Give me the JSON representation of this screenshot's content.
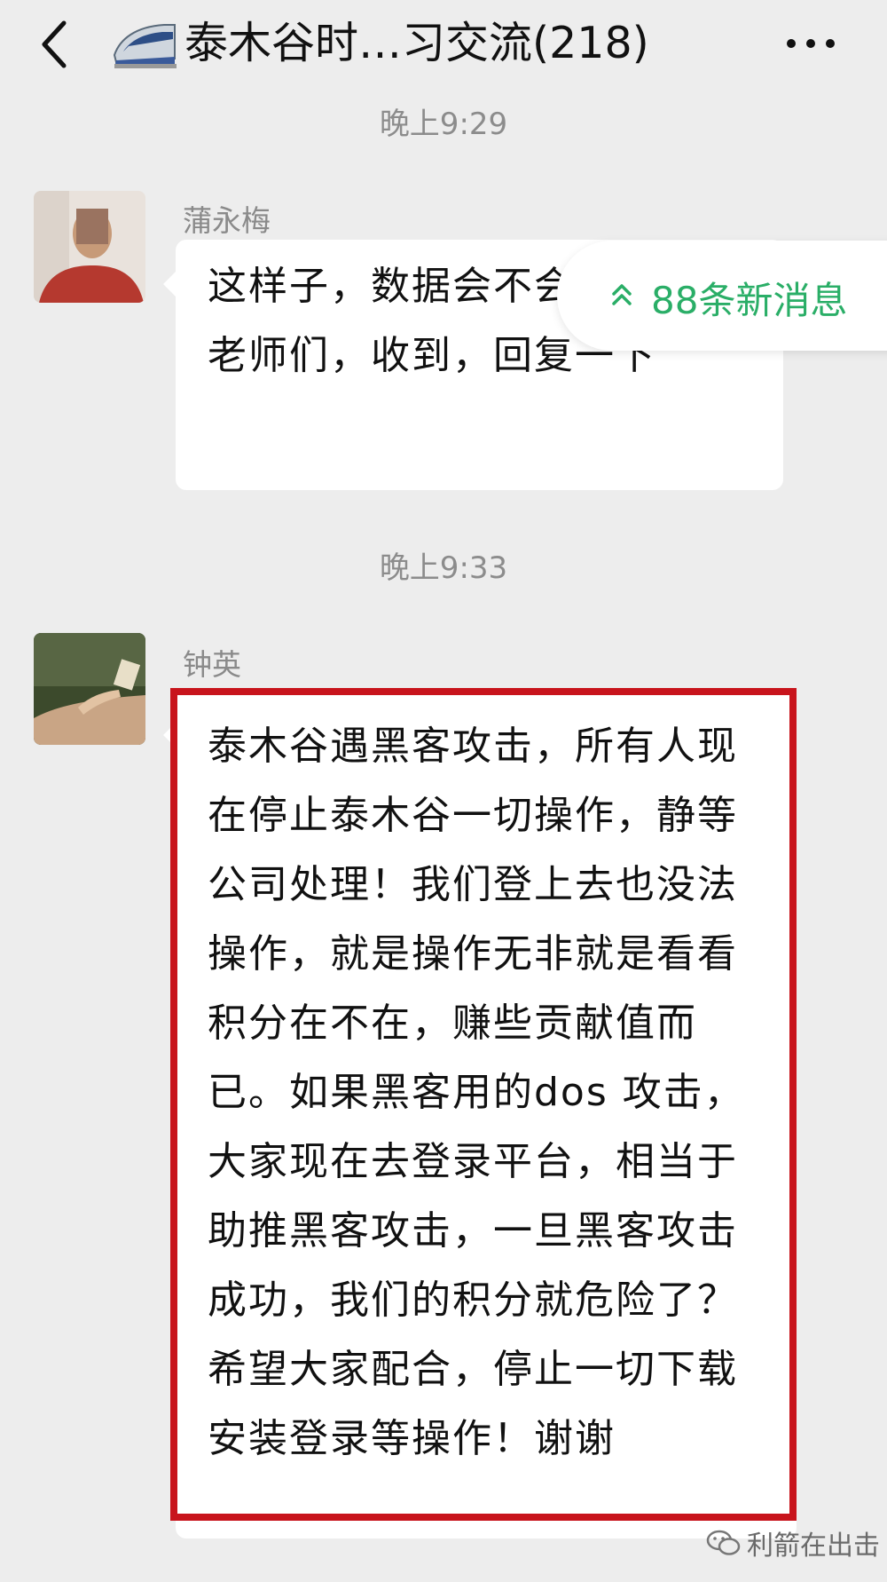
{
  "header": {
    "back_icon": "chevron-left-icon",
    "group_icon": "train-icon",
    "title": "泰木谷时…习交流(218)",
    "more_icon": "more-dots-icon"
  },
  "messages": [
    {
      "time": "晚上9:29",
      "sender": "蒲永梅",
      "text": "这样子，数据会不会丢失哟，老师们，收到，回复一下"
    },
    {
      "time": "晚上9:33",
      "sender": "钟英",
      "text": "泰木谷遇黑客攻击，所有人现在停止泰木谷一切操作，静等公司处理！我们登上去也没法操作，就是操作无非就是看看积分在不在，赚些贡献值而已。如果黑客用的dos 攻击，大家现在去登录平台，相当于助推黑客攻击，一旦黑客攻击成功，我们的积分就危险了？希望大家配合，停止一切下载安装登录等操作！谢谢"
    }
  ],
  "new_messages": {
    "icon": "double-chevron-up-icon",
    "label": "88条新消息",
    "color": "#2aae67"
  },
  "highlight_color": "#c8141c",
  "watermark": {
    "icon": "wechat-icon",
    "text": "利箭在出击"
  }
}
